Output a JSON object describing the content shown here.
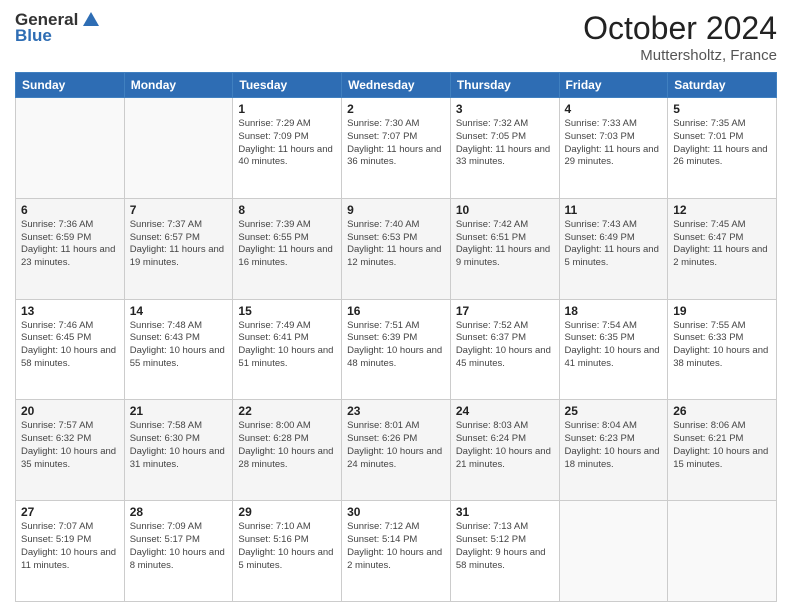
{
  "logo": {
    "general": "General",
    "blue": "Blue"
  },
  "header": {
    "month": "October 2024",
    "location": "Muttersholtz, France"
  },
  "days_of_week": [
    "Sunday",
    "Monday",
    "Tuesday",
    "Wednesday",
    "Thursday",
    "Friday",
    "Saturday"
  ],
  "weeks": [
    [
      {
        "day": null
      },
      {
        "day": null
      },
      {
        "day": "1",
        "sunrise": "Sunrise: 7:29 AM",
        "sunset": "Sunset: 7:09 PM",
        "daylight": "Daylight: 11 hours and 40 minutes."
      },
      {
        "day": "2",
        "sunrise": "Sunrise: 7:30 AM",
        "sunset": "Sunset: 7:07 PM",
        "daylight": "Daylight: 11 hours and 36 minutes."
      },
      {
        "day": "3",
        "sunrise": "Sunrise: 7:32 AM",
        "sunset": "Sunset: 7:05 PM",
        "daylight": "Daylight: 11 hours and 33 minutes."
      },
      {
        "day": "4",
        "sunrise": "Sunrise: 7:33 AM",
        "sunset": "Sunset: 7:03 PM",
        "daylight": "Daylight: 11 hours and 29 minutes."
      },
      {
        "day": "5",
        "sunrise": "Sunrise: 7:35 AM",
        "sunset": "Sunset: 7:01 PM",
        "daylight": "Daylight: 11 hours and 26 minutes."
      }
    ],
    [
      {
        "day": "6",
        "sunrise": "Sunrise: 7:36 AM",
        "sunset": "Sunset: 6:59 PM",
        "daylight": "Daylight: 11 hours and 23 minutes."
      },
      {
        "day": "7",
        "sunrise": "Sunrise: 7:37 AM",
        "sunset": "Sunset: 6:57 PM",
        "daylight": "Daylight: 11 hours and 19 minutes."
      },
      {
        "day": "8",
        "sunrise": "Sunrise: 7:39 AM",
        "sunset": "Sunset: 6:55 PM",
        "daylight": "Daylight: 11 hours and 16 minutes."
      },
      {
        "day": "9",
        "sunrise": "Sunrise: 7:40 AM",
        "sunset": "Sunset: 6:53 PM",
        "daylight": "Daylight: 11 hours and 12 minutes."
      },
      {
        "day": "10",
        "sunrise": "Sunrise: 7:42 AM",
        "sunset": "Sunset: 6:51 PM",
        "daylight": "Daylight: 11 hours and 9 minutes."
      },
      {
        "day": "11",
        "sunrise": "Sunrise: 7:43 AM",
        "sunset": "Sunset: 6:49 PM",
        "daylight": "Daylight: 11 hours and 5 minutes."
      },
      {
        "day": "12",
        "sunrise": "Sunrise: 7:45 AM",
        "sunset": "Sunset: 6:47 PM",
        "daylight": "Daylight: 11 hours and 2 minutes."
      }
    ],
    [
      {
        "day": "13",
        "sunrise": "Sunrise: 7:46 AM",
        "sunset": "Sunset: 6:45 PM",
        "daylight": "Daylight: 10 hours and 58 minutes."
      },
      {
        "day": "14",
        "sunrise": "Sunrise: 7:48 AM",
        "sunset": "Sunset: 6:43 PM",
        "daylight": "Daylight: 10 hours and 55 minutes."
      },
      {
        "day": "15",
        "sunrise": "Sunrise: 7:49 AM",
        "sunset": "Sunset: 6:41 PM",
        "daylight": "Daylight: 10 hours and 51 minutes."
      },
      {
        "day": "16",
        "sunrise": "Sunrise: 7:51 AM",
        "sunset": "Sunset: 6:39 PM",
        "daylight": "Daylight: 10 hours and 48 minutes."
      },
      {
        "day": "17",
        "sunrise": "Sunrise: 7:52 AM",
        "sunset": "Sunset: 6:37 PM",
        "daylight": "Daylight: 10 hours and 45 minutes."
      },
      {
        "day": "18",
        "sunrise": "Sunrise: 7:54 AM",
        "sunset": "Sunset: 6:35 PM",
        "daylight": "Daylight: 10 hours and 41 minutes."
      },
      {
        "day": "19",
        "sunrise": "Sunrise: 7:55 AM",
        "sunset": "Sunset: 6:33 PM",
        "daylight": "Daylight: 10 hours and 38 minutes."
      }
    ],
    [
      {
        "day": "20",
        "sunrise": "Sunrise: 7:57 AM",
        "sunset": "Sunset: 6:32 PM",
        "daylight": "Daylight: 10 hours and 35 minutes."
      },
      {
        "day": "21",
        "sunrise": "Sunrise: 7:58 AM",
        "sunset": "Sunset: 6:30 PM",
        "daylight": "Daylight: 10 hours and 31 minutes."
      },
      {
        "day": "22",
        "sunrise": "Sunrise: 8:00 AM",
        "sunset": "Sunset: 6:28 PM",
        "daylight": "Daylight: 10 hours and 28 minutes."
      },
      {
        "day": "23",
        "sunrise": "Sunrise: 8:01 AM",
        "sunset": "Sunset: 6:26 PM",
        "daylight": "Daylight: 10 hours and 24 minutes."
      },
      {
        "day": "24",
        "sunrise": "Sunrise: 8:03 AM",
        "sunset": "Sunset: 6:24 PM",
        "daylight": "Daylight: 10 hours and 21 minutes."
      },
      {
        "day": "25",
        "sunrise": "Sunrise: 8:04 AM",
        "sunset": "Sunset: 6:23 PM",
        "daylight": "Daylight: 10 hours and 18 minutes."
      },
      {
        "day": "26",
        "sunrise": "Sunrise: 8:06 AM",
        "sunset": "Sunset: 6:21 PM",
        "daylight": "Daylight: 10 hours and 15 minutes."
      }
    ],
    [
      {
        "day": "27",
        "sunrise": "Sunrise: 7:07 AM",
        "sunset": "Sunset: 5:19 PM",
        "daylight": "Daylight: 10 hours and 11 minutes."
      },
      {
        "day": "28",
        "sunrise": "Sunrise: 7:09 AM",
        "sunset": "Sunset: 5:17 PM",
        "daylight": "Daylight: 10 hours and 8 minutes."
      },
      {
        "day": "29",
        "sunrise": "Sunrise: 7:10 AM",
        "sunset": "Sunset: 5:16 PM",
        "daylight": "Daylight: 10 hours and 5 minutes."
      },
      {
        "day": "30",
        "sunrise": "Sunrise: 7:12 AM",
        "sunset": "Sunset: 5:14 PM",
        "daylight": "Daylight: 10 hours and 2 minutes."
      },
      {
        "day": "31",
        "sunrise": "Sunrise: 7:13 AM",
        "sunset": "Sunset: 5:12 PM",
        "daylight": "Daylight: 9 hours and 58 minutes."
      },
      {
        "day": null
      },
      {
        "day": null
      }
    ]
  ]
}
